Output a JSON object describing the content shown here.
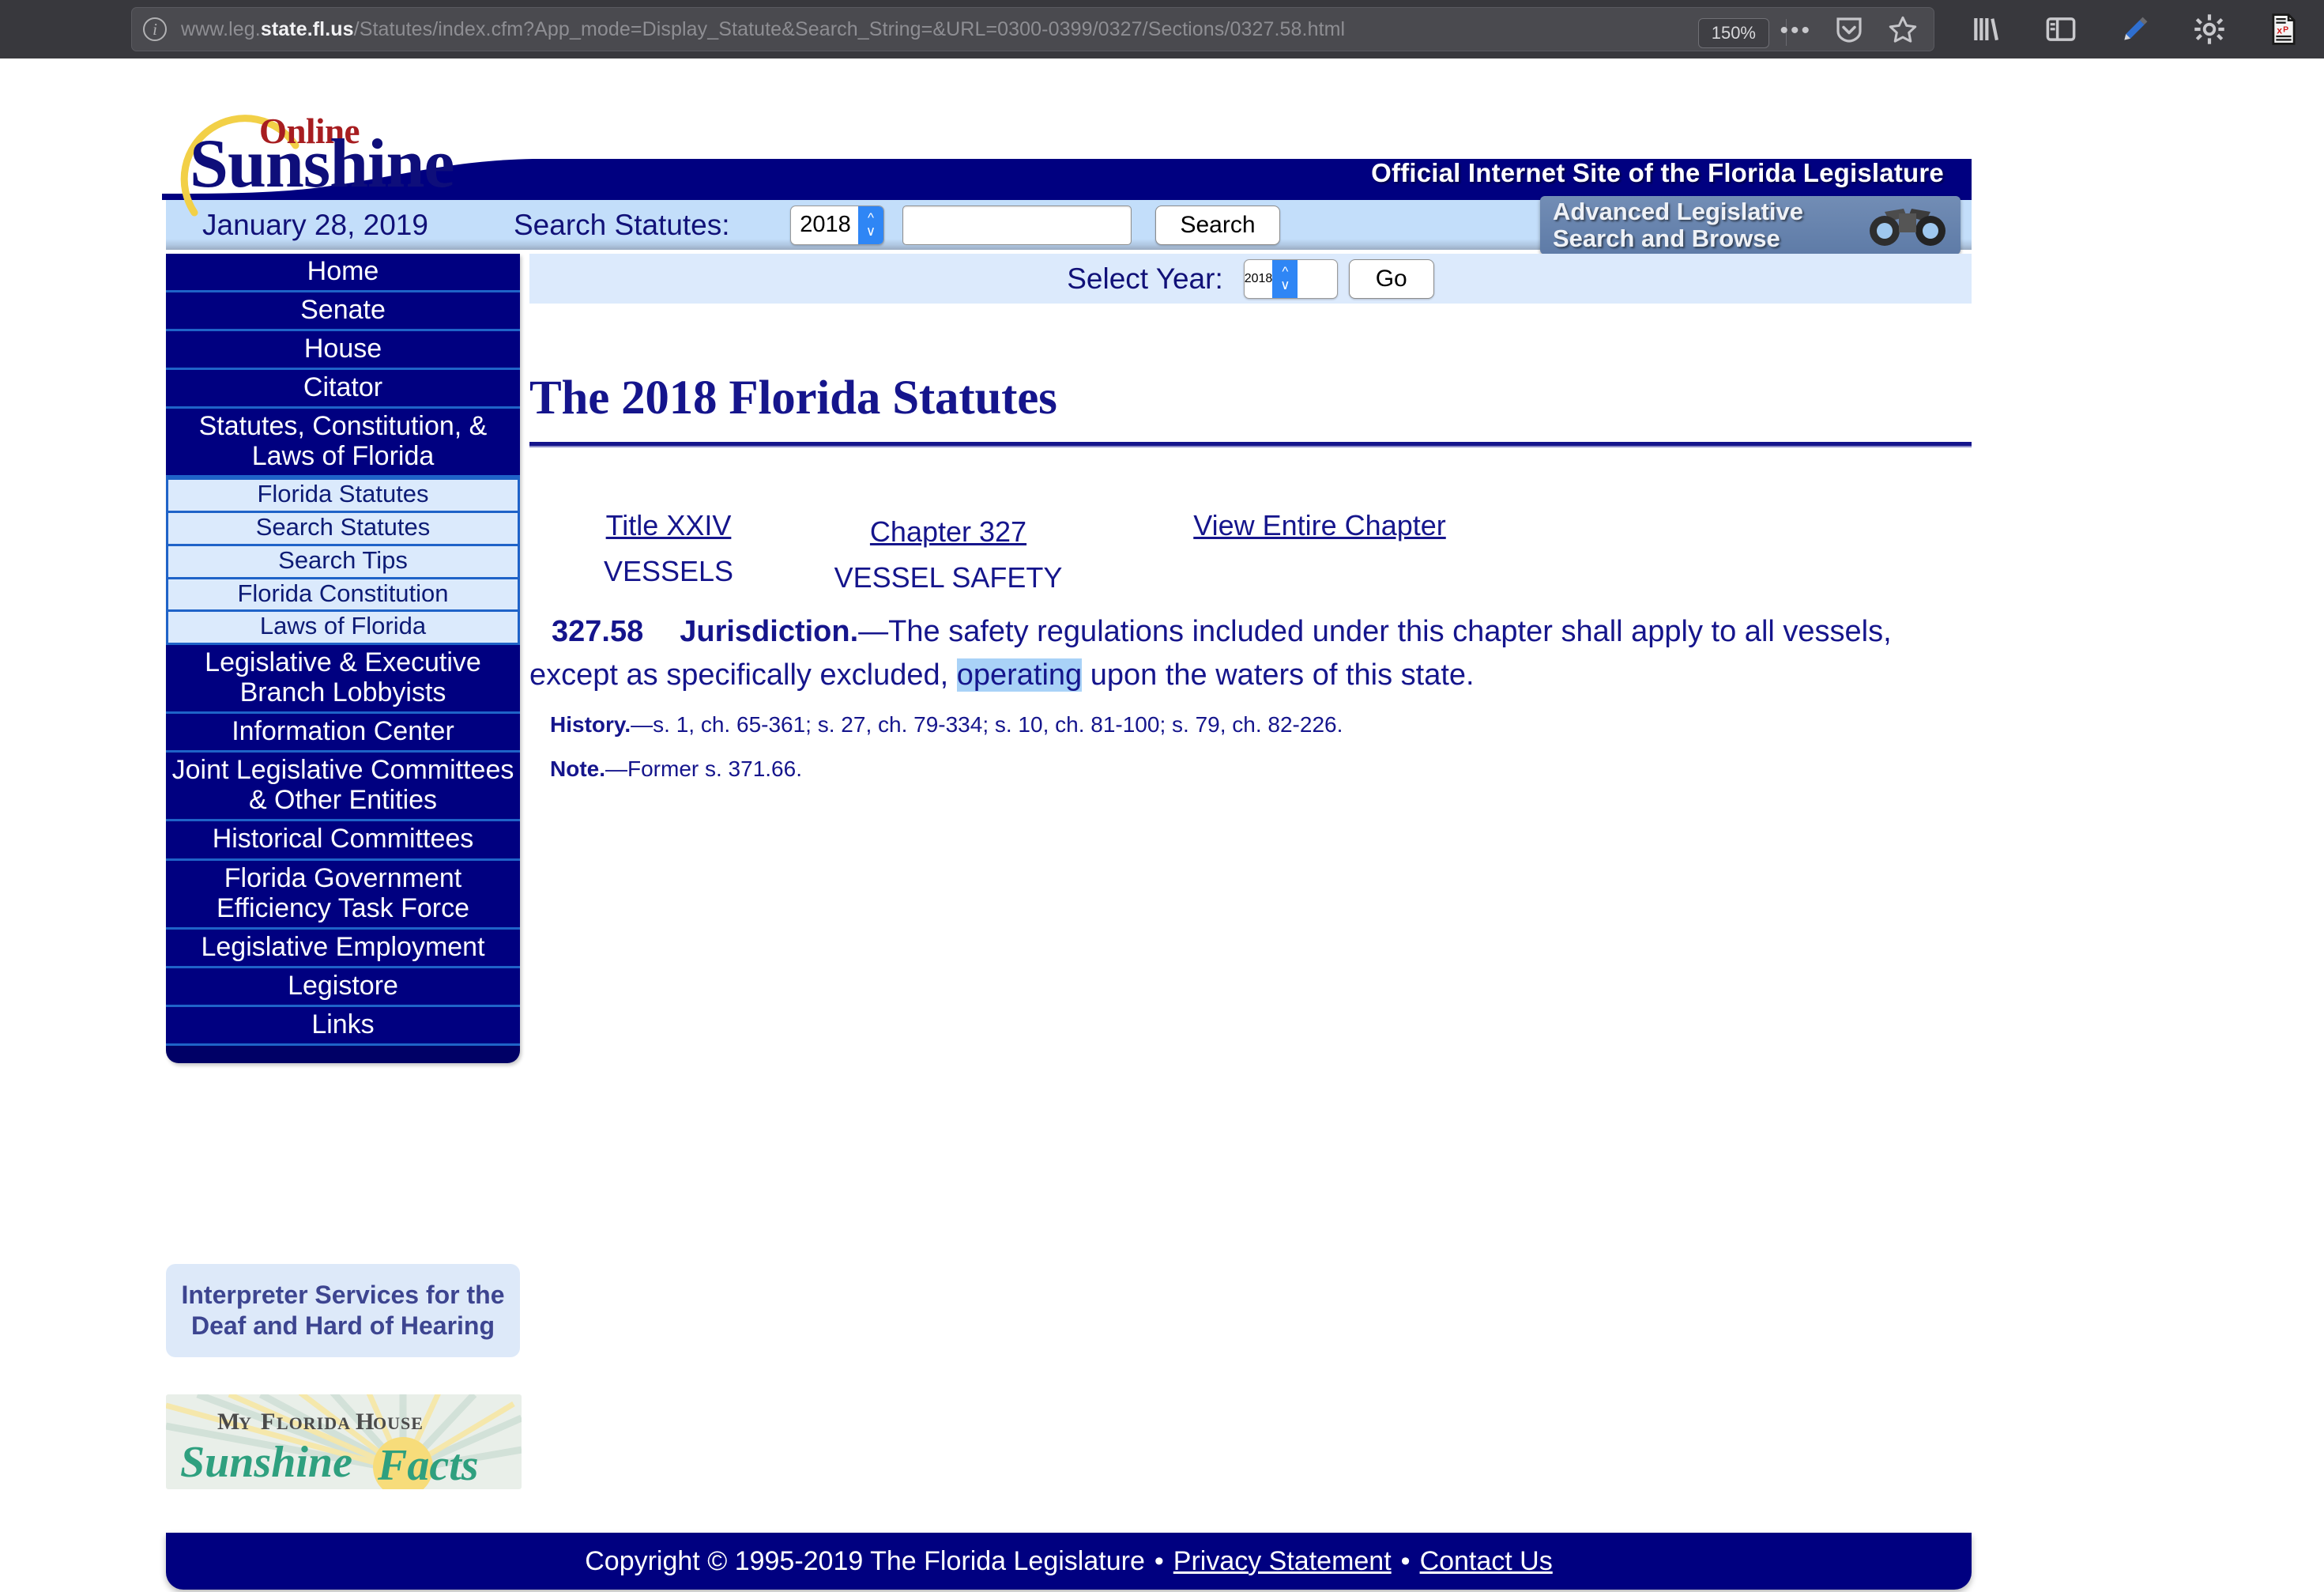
{
  "browser": {
    "url_prefix": "www.leg.",
    "url_host": "state.fl.us",
    "url_path": "/Statutes/index.cfm?App_mode=Display_Statute&Search_String=&URL=0300-0399/0327/Sections/0327.58.html",
    "zoom_level": "150%",
    "info_icon": "info-icon",
    "page_actions_icon": "ellipsis-icon",
    "pocket_icon": "pocket-shield-icon",
    "bookmark_icon": "star-icon",
    "library_icon": "library-books-icon",
    "sidebar_icon": "sidebar-panel-icon",
    "highlighter_icon": "highlighter-pen-icon",
    "gear_icon": "gear-icon",
    "xp_doc_icon": "xp-document-icon"
  },
  "logo": {
    "online": "Online",
    "sunshine": "Sunshine",
    "sun_arc": "sun-arc-icon"
  },
  "header": {
    "official_site": "Official Internet Site of the Florida Legislature"
  },
  "search_strip": {
    "date": "January 28, 2019",
    "label": "Search Statutes:",
    "year_value": "2018",
    "query_value": "",
    "query_placeholder": "",
    "search_button": "Search",
    "advanced_line1": "Advanced Legislative",
    "advanced_line2": "Search and Browse",
    "binoculars_icon": "binoculars-icon"
  },
  "sidebar": {
    "items": [
      {
        "label": "Home",
        "type": "main"
      },
      {
        "label": "Senate",
        "type": "main"
      },
      {
        "label": "House",
        "type": "main"
      },
      {
        "label": "Citator",
        "type": "main"
      },
      {
        "label": "Statutes, Constitution, & Laws of Florida",
        "type": "main"
      },
      {
        "label": "Florida Statutes",
        "type": "sub"
      },
      {
        "label": "Search Statutes",
        "type": "sub"
      },
      {
        "label": "Search Tips",
        "type": "sub"
      },
      {
        "label": "Florida Constitution",
        "type": "sub"
      },
      {
        "label": "Laws of Florida",
        "type": "sub"
      },
      {
        "label": "Legislative & Executive Branch Lobbyists",
        "type": "main"
      },
      {
        "label": "Information Center",
        "type": "main"
      },
      {
        "label": "Joint Legislative Committees & Other Entities",
        "type": "main"
      },
      {
        "label": "Historical Committees",
        "type": "main"
      },
      {
        "label": "Florida Government Efficiency Task Force",
        "type": "main"
      },
      {
        "label": "Legislative Employment",
        "type": "main"
      },
      {
        "label": "Legistore",
        "type": "main"
      },
      {
        "label": "Links",
        "type": "main"
      }
    ]
  },
  "promos": {
    "interpreter_line1": "Interpreter Services for the",
    "interpreter_line2": "Deaf and Hard of Hearing",
    "facts_line1": "My Florida House",
    "facts_line2": "Sunshine Facts"
  },
  "main": {
    "select_year_label": "Select Year:",
    "select_year_value": "2018",
    "go_button": "Go",
    "page_title": "The 2018 Florida Statutes",
    "title_link": "Title XXIV",
    "title_sub": "VESSELS",
    "chapter_link": "Chapter 327",
    "chapter_sub": "VESSEL SAFETY",
    "view_entire_chapter": "View Entire Chapter",
    "statute_number": "327.58",
    "statute_heading": "Jurisdiction.",
    "statute_body_1": "—The safety regulations included under this chapter shall apply to all vessels, except as specifically excluded, ",
    "statute_highlight": "operating",
    "statute_body_2": " upon the waters of this state.",
    "history_label": "History.",
    "history_text": "—s. 1, ch. 65-361; s. 27, ch. 79-334; s. 10, ch. 81-100; s. 79, ch. 82-226.",
    "note_label": "Note.",
    "note_text": "—Former s. 371.66."
  },
  "footer": {
    "copyright": "Copyright © 1995-2019 The Florida Legislature",
    "privacy": "Privacy Statement",
    "contact": "Contact Us",
    "separator": "•"
  },
  "colors": {
    "navy": "#000080",
    "light_blue": "#dceafc",
    "link_navy": "#15158c",
    "highlight": "#a9d2f7",
    "logo_red": "#a71d20",
    "sun_yellow": "#f2d047"
  }
}
